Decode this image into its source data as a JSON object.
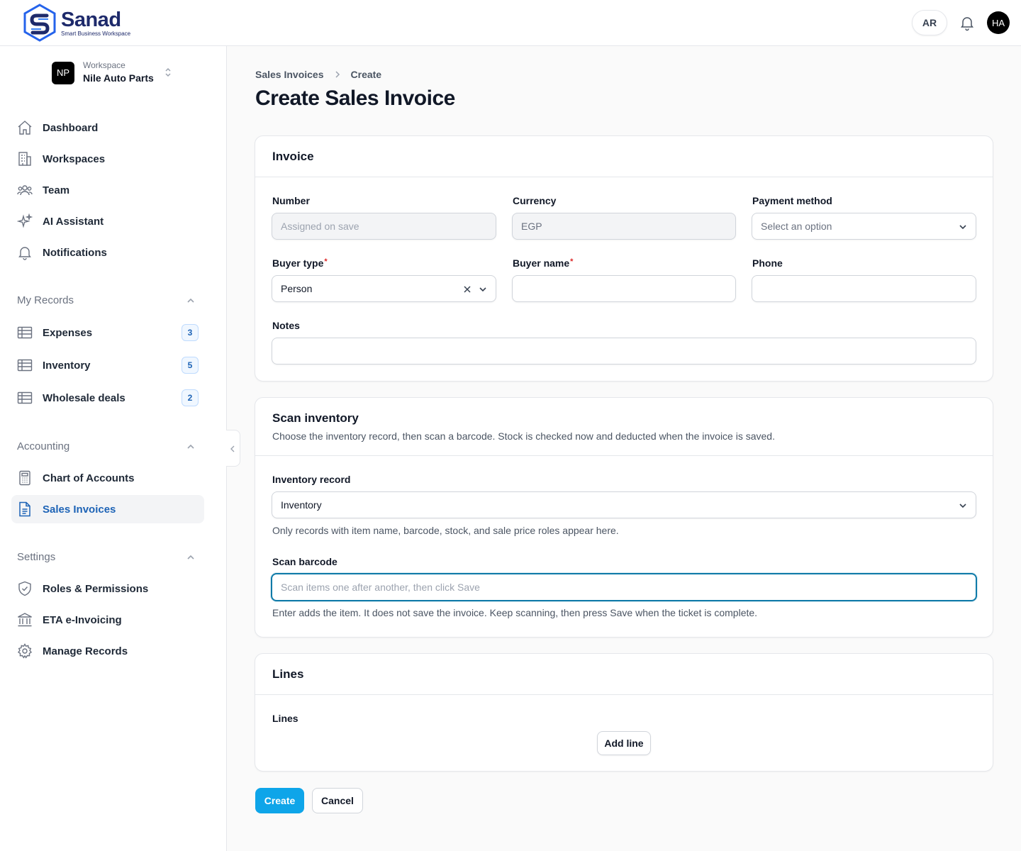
{
  "app": {
    "name": "Sanad",
    "tagline": "Smart Business Workspace",
    "language_toggle": "AR",
    "user_initials": "HA"
  },
  "workspace": {
    "label": "Workspace",
    "name": "Nile Auto Parts",
    "initials": "NP"
  },
  "sidebar": {
    "main_items": [
      {
        "label": "Dashboard",
        "icon": "home-icon"
      },
      {
        "label": "Workspaces",
        "icon": "building-icon"
      },
      {
        "label": "Team",
        "icon": "users-icon"
      },
      {
        "label": "AI Assistant",
        "icon": "sparkles-icon"
      },
      {
        "label": "Notifications",
        "icon": "bell-icon"
      }
    ],
    "my_records": {
      "title": "My Records",
      "items": [
        {
          "label": "Expenses",
          "count": "3",
          "icon": "table-icon"
        },
        {
          "label": "Inventory",
          "count": "5",
          "icon": "table-icon"
        },
        {
          "label": "Wholesale deals",
          "count": "2",
          "icon": "table-icon"
        }
      ]
    },
    "accounting": {
      "title": "Accounting",
      "items": [
        {
          "label": "Chart of Accounts",
          "icon": "calculator-icon"
        },
        {
          "label": "Sales Invoices",
          "icon": "document-icon",
          "active": true
        }
      ]
    },
    "settings": {
      "title": "Settings",
      "items": [
        {
          "label": "Roles & Permissions",
          "icon": "shield-check-icon"
        },
        {
          "label": "ETA e-Invoicing",
          "icon": "bank-icon"
        },
        {
          "label": "Manage Records",
          "icon": "gear-icon"
        }
      ]
    }
  },
  "breadcrumb": {
    "parent": "Sales Invoices",
    "current": "Create"
  },
  "page_title": "Create Sales Invoice",
  "invoice_section": {
    "title": "Invoice",
    "number": {
      "label": "Number",
      "placeholder": "Assigned on save"
    },
    "currency": {
      "label": "Currency",
      "value": "EGP"
    },
    "payment_method": {
      "label": "Payment method",
      "placeholder": "Select an option"
    },
    "buyer_type": {
      "label": "Buyer type",
      "required_mark": "*",
      "value": "Person"
    },
    "buyer_name": {
      "label": "Buyer name",
      "required_mark": "*",
      "value": ""
    },
    "phone": {
      "label": "Phone",
      "value": ""
    },
    "notes": {
      "label": "Notes",
      "value": ""
    }
  },
  "scan_section": {
    "title": "Scan inventory",
    "description": "Choose the inventory record, then scan a barcode. Stock is checked now and deducted when the invoice is saved.",
    "inventory_record": {
      "label": "Inventory record",
      "value": "Inventory",
      "helper": "Only records with item name, barcode, stock, and sale price roles appear here."
    },
    "scan_barcode": {
      "label": "Scan barcode",
      "placeholder": "Scan items one after another, then click Save",
      "helper": "Enter adds the item. It does not save the invoice. Keep scanning, then press Save when the ticket is complete."
    }
  },
  "lines_section": {
    "title": "Lines",
    "field_label": "Lines",
    "add_button": "Add line"
  },
  "actions": {
    "create": "Create",
    "cancel": "Cancel"
  },
  "colors": {
    "primary": "#0ea5e9",
    "active_nav": "#1d63b6",
    "focus_ring": "#0e7aa8",
    "required": "#dc2626"
  }
}
